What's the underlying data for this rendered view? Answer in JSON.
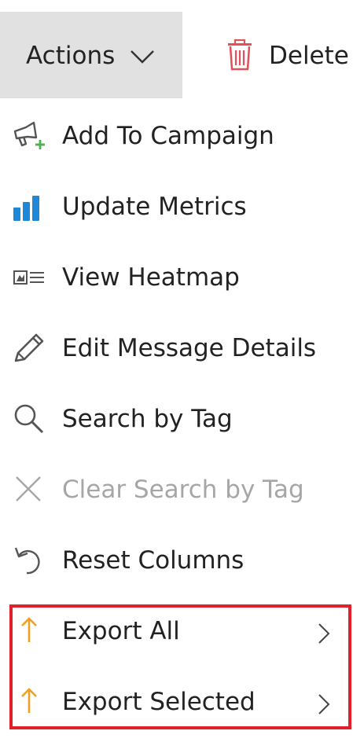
{
  "toolbar": {
    "actions_label": "Actions",
    "delete_label": "Delete"
  },
  "colors": {
    "actions_bg": "#e1e1e1",
    "delete_icon": "#e2505a",
    "campaign_plus": "#4caf50",
    "metrics_blue": "#1e88d8",
    "export_arrow": "#f0a020",
    "highlight_border": "#e0202b",
    "disabled_text": "#a6a6a6"
  },
  "menu": {
    "items": [
      {
        "label": "Add To Campaign",
        "icon": "megaphone-add-icon",
        "disabled": false
      },
      {
        "label": "Update Metrics",
        "icon": "bar-chart-icon",
        "disabled": false
      },
      {
        "label": "View Heatmap",
        "icon": "heatmap-icon",
        "disabled": false
      },
      {
        "label": "Edit Message Details",
        "icon": "pencil-icon",
        "disabled": false
      },
      {
        "label": "Search by Tag",
        "icon": "search-icon",
        "disabled": false
      },
      {
        "label": "Clear Search by Tag",
        "icon": "close-icon",
        "disabled": true
      },
      {
        "label": "Reset Columns",
        "icon": "undo-icon",
        "disabled": false
      },
      {
        "label": "Export All",
        "icon": "export-arrow-icon",
        "disabled": false,
        "has_submenu": true
      },
      {
        "label": "Export Selected",
        "icon": "export-arrow-icon",
        "disabled": false,
        "has_submenu": true
      }
    ]
  }
}
